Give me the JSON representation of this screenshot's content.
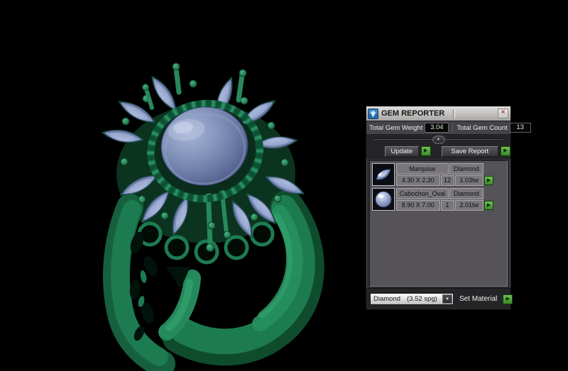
{
  "icons": {
    "close": "×",
    "green_arrow": "▶",
    "dropdown_arrow": "▼",
    "collapse_arrow": "▲"
  },
  "colors": {
    "viewport_bg": "#000000",
    "ring_green": "#1f7e54",
    "gem_blue": "#8b9cc8",
    "action_green": "#4ea33f",
    "panel_bg": "#2b2a2d",
    "table_bg": "#555358"
  },
  "gem_reporter": {
    "title": "GEM REPORTER",
    "totals": {
      "weight_label": "Total Gem Weight",
      "weight_value": "3.04",
      "count_label": "Total Gem Count",
      "count_value": "13"
    },
    "actions": {
      "update_label": "Update",
      "save_report_label": "Save Report",
      "set_material_label": "Set Material"
    },
    "gems": [
      {
        "shape": "Marquise",
        "material": "Diamond",
        "dimensions": "4.30 X 2.30",
        "count": "12",
        "total_weight": "1.03tw"
      },
      {
        "shape": "Cabochon_Oval",
        "material": "Diamond",
        "dimensions": "8.90 X 7.00",
        "count": "1",
        "total_weight": "2.01tw"
      }
    ],
    "material_dropdown": {
      "selected_material": "Diamond",
      "specific_gravity": "(3.52 spg)"
    }
  }
}
